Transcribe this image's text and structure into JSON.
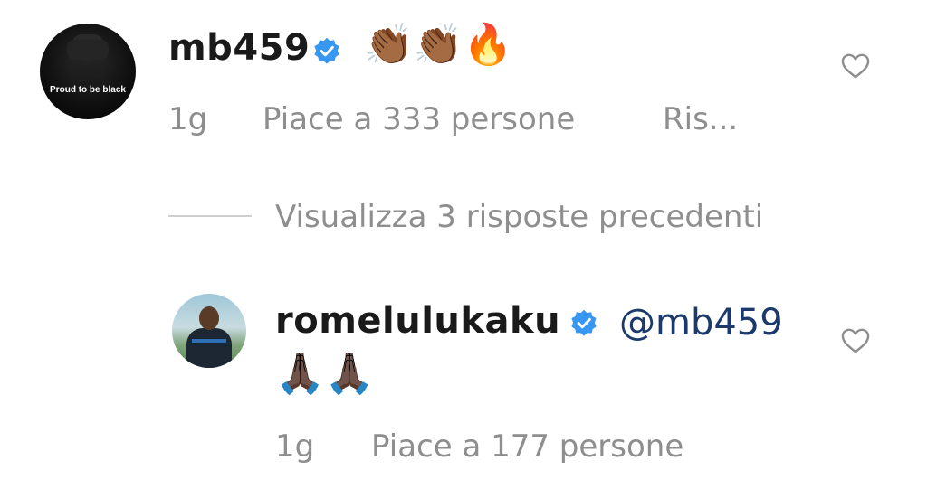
{
  "comment": {
    "username": "mb459",
    "avatar_caption": "Proud to be black",
    "text": "👏🏾👏🏾🔥",
    "age": "1g",
    "likes": "Piace a 333 persone",
    "reply_label": "Ris..."
  },
  "thread": {
    "view_replies": "Visualizza 3 risposte precedenti"
  },
  "reply": {
    "username": "romelulukaku",
    "mention": "@mb459",
    "text": "🙏🏿🙏🏿",
    "age": "1g",
    "likes": "Piace a 177 persone"
  },
  "colors": {
    "verified_blue": "#3897f0",
    "meta_gray": "#8e8e8e",
    "mention_blue": "#1b3a6b"
  },
  "icons": {
    "verified": "verified-badge-icon",
    "like": "heart-outline-icon"
  }
}
